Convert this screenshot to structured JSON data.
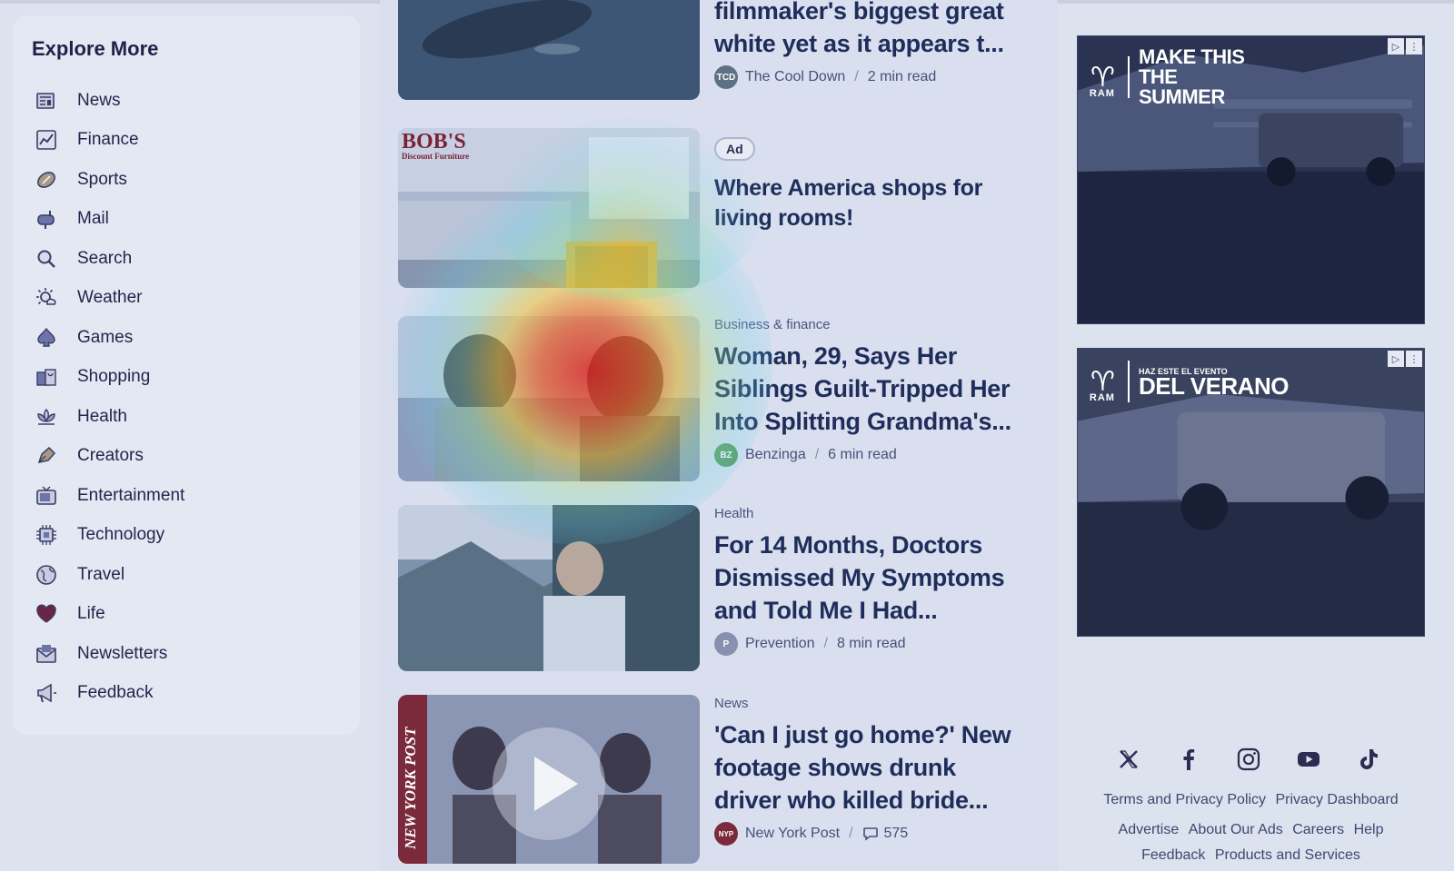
{
  "sidebar": {
    "title": "Explore More",
    "items": [
      {
        "label": "News",
        "icon": "newspaper-icon"
      },
      {
        "label": "Finance",
        "icon": "chart-icon"
      },
      {
        "label": "Sports",
        "icon": "football-icon"
      },
      {
        "label": "Mail",
        "icon": "mailbox-icon"
      },
      {
        "label": "Search",
        "icon": "magnifier-icon"
      },
      {
        "label": "Weather",
        "icon": "sun-cloud-icon"
      },
      {
        "label": "Games",
        "icon": "spade-icon"
      },
      {
        "label": "Shopping",
        "icon": "shopping-bag-icon"
      },
      {
        "label": "Health",
        "icon": "lotus-icon"
      },
      {
        "label": "Creators",
        "icon": "pen-nib-icon"
      },
      {
        "label": "Entertainment",
        "icon": "tv-icon"
      },
      {
        "label": "Technology",
        "icon": "chip-icon"
      },
      {
        "label": "Travel",
        "icon": "globe-icon"
      },
      {
        "label": "Life",
        "icon": "heart-icon"
      },
      {
        "label": "Newsletters",
        "icon": "envelope-icon"
      },
      {
        "label": "Feedback",
        "icon": "megaphone-icon"
      }
    ]
  },
  "feed": {
    "stories": [
      {
        "headline": "filmmaker's biggest great white yet as it appears t...",
        "source": "The Cool Down",
        "source_logo": "TCD",
        "read_time": "2 min read"
      },
      {
        "ad_label": "Ad",
        "headline": "Where America shops for living rooms!",
        "thumb_brand": "BOB'S",
        "thumb_brand_sub": "Discount Furniture"
      },
      {
        "category": "Business & finance",
        "headline": "Woman, 29, Says Her Siblings Guilt-Tripped Her Into Splitting Grandma's...",
        "source": "Benzinga",
        "source_logo": "BZ",
        "read_time": "6 min read"
      },
      {
        "category": "Health",
        "headline": "For 14 Months, Doctors Dismissed My Symptoms and Told Me I Had...",
        "source": "Prevention",
        "source_logo": "P",
        "read_time": "8 min read"
      },
      {
        "category": "News",
        "headline": "'Can I just go home?' New footage shows drunk driver who killed bride...",
        "source": "New York Post",
        "source_logo": "NYP",
        "comments": "575",
        "thumb_brand": "NEW YORK POST"
      }
    ]
  },
  "ads": [
    {
      "brand": "RAM",
      "slogan": "MAKE THIS THE SUMMER",
      "slogan_small": ""
    },
    {
      "brand": "RAM",
      "slogan": "DEL VERANO",
      "slogan_small": "HAZ ESTE EL EVENTO"
    }
  ],
  "social": [
    "x-icon",
    "facebook-icon",
    "instagram-icon",
    "youtube-icon",
    "tiktok-icon"
  ],
  "footer": {
    "terms": "Terms and Privacy Policy",
    "privacy": "Privacy Dashboard",
    "advertise": "Advertise",
    "about_ads": "About Our Ads",
    "careers": "Careers",
    "help": "Help",
    "feedback": "Feedback",
    "products": "Products and Services"
  },
  "colors": {
    "page_bg": "#dde2ef",
    "headline": "#1e2d5a",
    "heat_hot": "#e0261f",
    "heat_warm": "#f2c230",
    "heat_cool": "#6ad3e8"
  }
}
